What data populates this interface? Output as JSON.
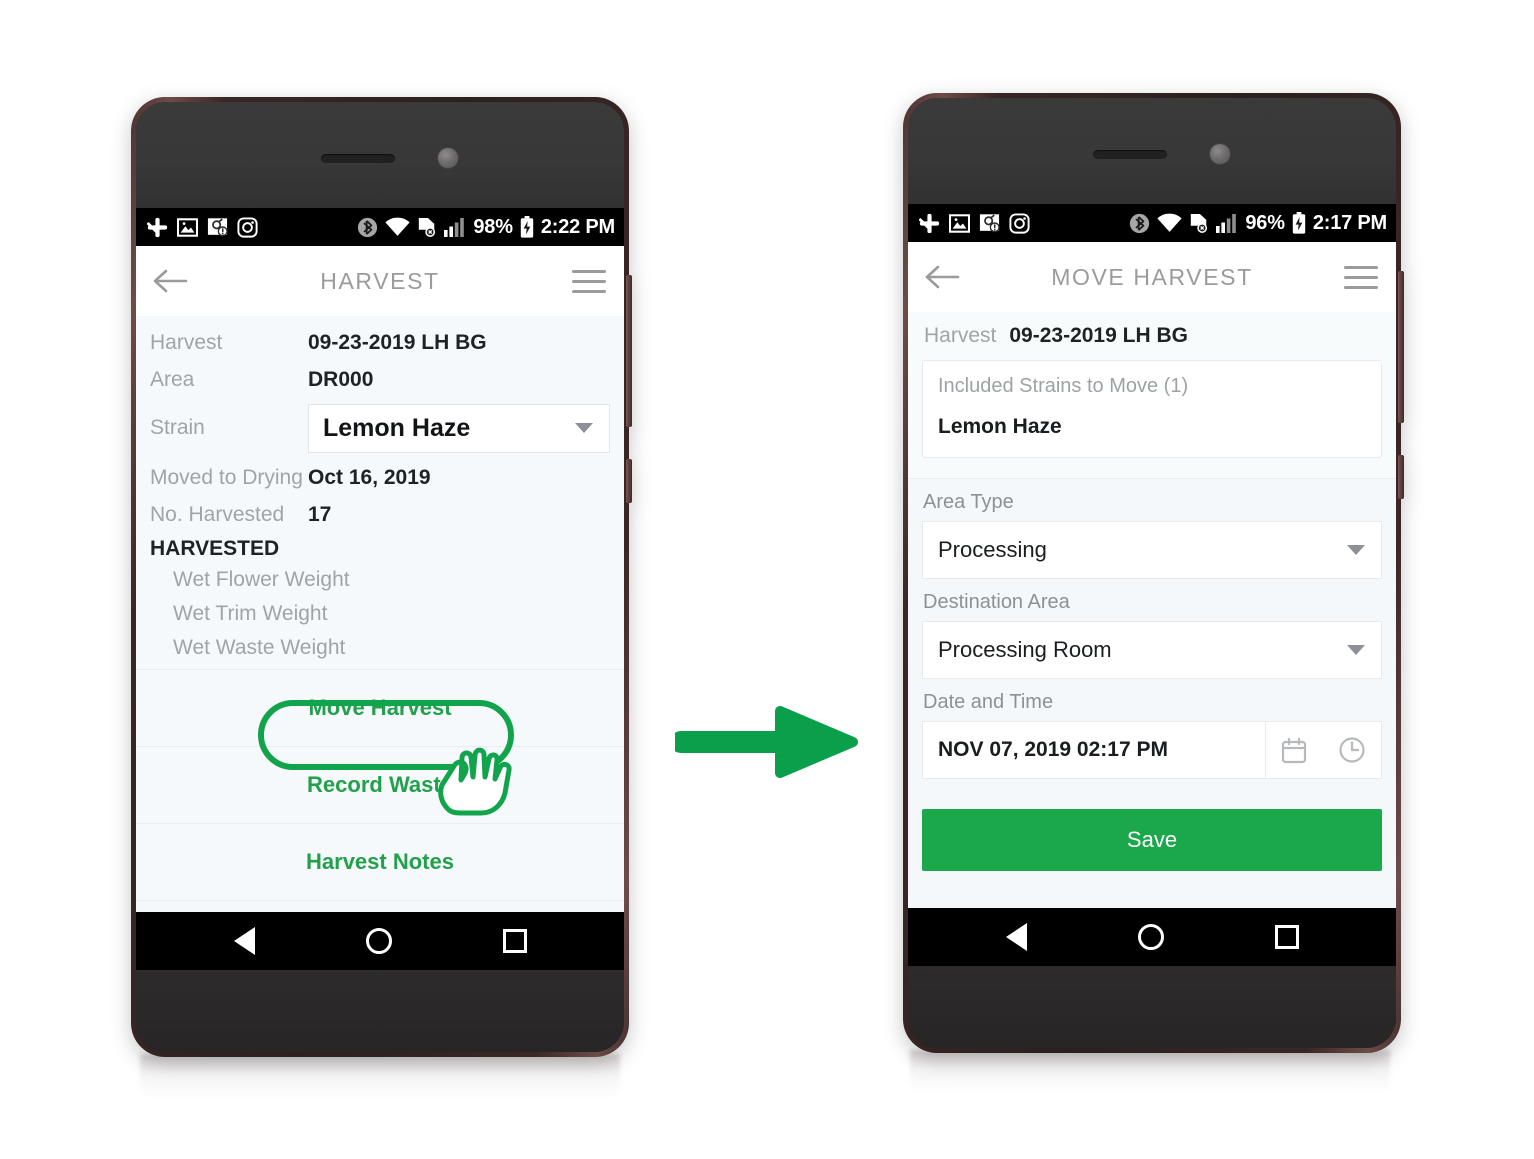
{
  "statusbar_left": {
    "app_icons": [
      "slack-icon",
      "gallery-icon",
      "screenshot-icon",
      "instagram-icon"
    ]
  },
  "left_phone": {
    "status": {
      "bluetooth": "bluetooth-icon",
      "wifi": "wifi-icon",
      "sync_error": "sync-error-icon",
      "signal": "signal-icon",
      "battery_percent": "98%",
      "battery": "battery-icon",
      "time": "2:22 PM"
    },
    "appbar": {
      "back": "back-arrow-icon",
      "title": "HARVEST",
      "menu": "hamburger-menu-icon"
    },
    "details": [
      {
        "label": "Harvest",
        "value": "09-23-2019 LH BG"
      },
      {
        "label": "Area",
        "value": "DR000"
      }
    ],
    "strain": {
      "label": "Strain",
      "value": "Lemon Haze",
      "caret": "chevron-down-icon"
    },
    "details2": [
      {
        "label": "Moved to Drying",
        "value": "Oct 16, 2019"
      },
      {
        "label": "No. Harvested",
        "value": "17"
      }
    ],
    "section_title": "HARVESTED",
    "harvest_rows": [
      "Wet Flower Weight",
      "Wet Trim Weight",
      "Wet Waste Weight"
    ],
    "actions": [
      "Move Harvest",
      "Record Waste",
      "Harvest Notes"
    ],
    "highlight": {
      "target": "Move Harvest",
      "color": "#12a44c",
      "cursor": "pointing-hand-cursor"
    },
    "navbar": [
      "back-triangle-icon",
      "home-circle-icon",
      "recents-square-icon"
    ]
  },
  "arrow": {
    "name": "flow-arrow",
    "color": "#0aa04b"
  },
  "right_phone": {
    "status": {
      "bluetooth": "bluetooth-icon",
      "wifi": "wifi-icon",
      "sync_error": "sync-error-icon",
      "signal": "signal-icon",
      "battery_percent": "96%",
      "battery": "battery-icon",
      "time": "2:17 PM"
    },
    "appbar": {
      "back": "back-arrow-icon",
      "title": "MOVE HARVEST",
      "menu": "hamburger-menu-icon"
    },
    "harvest": {
      "label": "Harvest",
      "value": "09-23-2019 LH BG"
    },
    "strains_card": {
      "caption": "Included Strains to Move (1)",
      "items": [
        "Lemon Haze"
      ]
    },
    "fields": [
      {
        "label": "Area Type",
        "value": "Processing",
        "caret": "chevron-down-icon"
      },
      {
        "label": "Destination Area",
        "value": "Processing Room",
        "caret": "chevron-down-icon"
      }
    ],
    "datetime": {
      "label": "Date and Time",
      "value": "NOV 07, 2019 02:17 PM",
      "calendar_icon": "calendar-icon",
      "clock_icon": "clock-icon"
    },
    "save_label": "Save",
    "save_color": "#1aa84a",
    "navbar": [
      "back-triangle-icon",
      "home-circle-icon",
      "recents-square-icon"
    ]
  }
}
